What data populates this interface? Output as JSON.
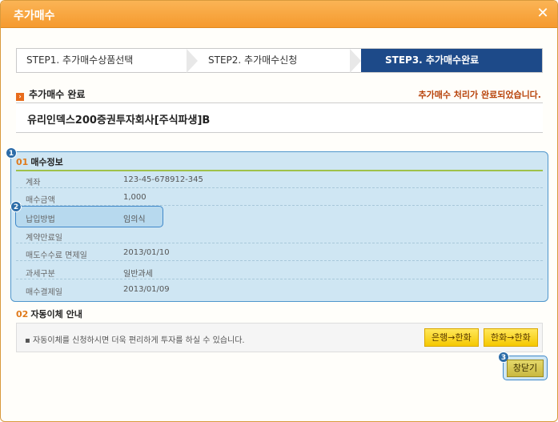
{
  "window": {
    "title": "추가매수",
    "close_glyph": "✕"
  },
  "steps": [
    {
      "label": "STEP1. 추가매수상품선택"
    },
    {
      "label": "STEP2. 추가매수신청"
    },
    {
      "label": "STEP3. 추가매수완료",
      "active": true
    }
  ],
  "section": {
    "title": "추가매수 완료",
    "message": "추가매수 처리가 완료되었습니다.",
    "product": "유리인덱스200증권투자회사[주식파생]B"
  },
  "purchase_info": {
    "number": "01",
    "title": "매수정보",
    "rows": [
      {
        "label": "계좌",
        "value": "123-45-678912-345"
      },
      {
        "label": "매수금액",
        "value": "1,000"
      },
      {
        "label": "납입방법",
        "value": "임의식"
      },
      {
        "label": "계약만료일",
        "value": ""
      },
      {
        "label": "매도수수료 면제일",
        "value": "2013/01/10"
      },
      {
        "label": "과세구분",
        "value": "일반과세"
      },
      {
        "label": "매수결제일",
        "value": "2013/01/09"
      }
    ]
  },
  "auto_transfer": {
    "number": "02",
    "title": "자동이체 안내",
    "text": "자동이체를 신청하시면 더욱 편리하게 투자를 하실 수 있습니다.",
    "btn_bank_to_hanwha": "은행→한화",
    "btn_hanwha_to_hanwha": "한화→한화"
  },
  "badges": [
    "1",
    "2",
    "3"
  ],
  "close_button": "창닫기",
  "colors": {
    "titlebar": "#f59a2e",
    "active_step": "#1d4a89",
    "panel": "#cfe6f3",
    "accent": "#e86c1c"
  }
}
